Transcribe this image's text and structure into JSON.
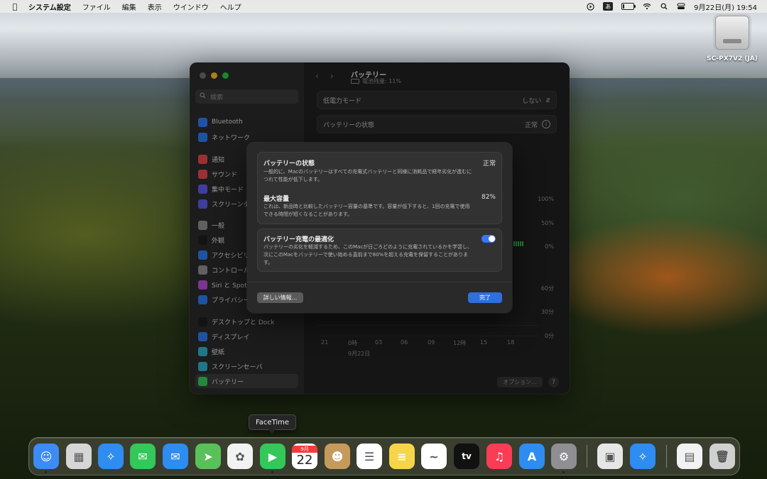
{
  "menubar": {
    "app_name": "システム設定",
    "menus": [
      "ファイル",
      "編集",
      "表示",
      "ウインドウ",
      "ヘルプ"
    ],
    "ime_label": "あ",
    "clock": "9月22日(月) 19:54",
    "battery_level": 0.11
  },
  "desktop": {
    "drive_label": "SC-PX7V2 (JA)"
  },
  "window": {
    "search_placeholder": "検索",
    "sidebar": [
      {
        "label": "Bluetooth",
        "icon": "bluetooth-icon",
        "color": "#2d7bf0"
      },
      {
        "label": "ネットワーク",
        "icon": "globe-icon",
        "color": "#2d7bf0"
      },
      {
        "label": "通知",
        "icon": "bell-icon",
        "color": "#e5484d"
      },
      {
        "label": "サウンド",
        "icon": "speaker-icon",
        "color": "#e5484d"
      },
      {
        "label": "集中モード",
        "icon": "moon-icon",
        "color": "#5e5ce6"
      },
      {
        "label": "スクリーンタ",
        "icon": "hourglass-icon",
        "color": "#5e5ce6"
      },
      {
        "label": "一般",
        "icon": "gear-icon",
        "color": "#8e8e93"
      },
      {
        "label": "外観",
        "icon": "appearance-icon",
        "color": "#1c1c1e"
      },
      {
        "label": "アクセシビリ",
        "icon": "accessibility-icon",
        "color": "#2d7bf0"
      },
      {
        "label": "コントロール",
        "icon": "control-center-icon",
        "color": "#8e8e93"
      },
      {
        "label": "Siri と Spotli",
        "icon": "siri-icon",
        "color": "#b44fd6"
      },
      {
        "label": "プライバシー",
        "icon": "hand-icon",
        "color": "#2d7bf0"
      },
      {
        "label": "デスクトップと Dock",
        "icon": "dock-icon",
        "color": "#1c1c1e"
      },
      {
        "label": "ディスプレイ",
        "icon": "sun-icon",
        "color": "#2d7bf0"
      },
      {
        "label": "壁紙",
        "icon": "wallpaper-icon",
        "color": "#30b0c7"
      },
      {
        "label": "スクリーンセーバ",
        "icon": "screensaver-icon",
        "color": "#30b0c7"
      },
      {
        "label": "バッテリー",
        "icon": "battery-icon",
        "color": "#34c759"
      }
    ],
    "title": "バッテリー",
    "subtitle": "電池残量: 11%",
    "low_power_label": "低電力モード",
    "low_power_value": "しない",
    "health_label": "バッテリーの状態",
    "health_value": "正常",
    "chart_percent_labels": [
      "100%",
      "50%",
      "0%"
    ],
    "chart_minute_labels": [
      "60分",
      "30分",
      "0分"
    ],
    "chart_x_labels": [
      "21",
      "0時",
      "03",
      "06",
      "09",
      "12時",
      "15",
      "18"
    ],
    "chart_date_label": "9月22日",
    "options_label": "オプション...",
    "help_label": "?"
  },
  "sheet": {
    "health_title": "バッテリーの状態",
    "health_value": "正常",
    "health_desc": "一般的に、Macのバッテリーはすべての充電式バッテリーと同様に消耗品で経年劣化が進むにつれて性能が低下します。",
    "capacity_title": "最大容量",
    "capacity_value": "82%",
    "capacity_desc": "これは、新品時と比較したバッテリー容量の基準です。容量が低下すると、1回の充電で使用できる時間が短くなることがあります。",
    "optimize_title": "バッテリー充電の最適化",
    "optimize_desc": "バッテリーの劣化を軽減するため、このMacが日ごろどのように充電されているかを学習し、次にこのMacをバッテリーで使い始める直前まで80%を超える充電を保留することがあります。",
    "optimize_on": true,
    "more_info_label": "詳しい情報...",
    "done_label": "完了"
  },
  "dock": {
    "tooltip": "FaceTime",
    "calendar_month": "9月",
    "calendar_day": "22",
    "tv_label": "tv",
    "apps": [
      {
        "name": "finder-icon",
        "color": "#3d8bf5"
      },
      {
        "name": "launchpad-icon",
        "color": "#d6d6d6"
      },
      {
        "name": "safari-icon",
        "color": "#2f8cf0"
      },
      {
        "name": "messages-icon",
        "color": "#34c759"
      },
      {
        "name": "mail-icon",
        "color": "#2f8cf0"
      },
      {
        "name": "maps-icon",
        "color": "#5ac05a"
      },
      {
        "name": "photos-icon",
        "color": "#f2f2f2"
      },
      {
        "name": "facetime-icon",
        "color": "#34c759"
      },
      {
        "name": "calendar-icon",
        "color": "#ffffff"
      },
      {
        "name": "contacts-icon",
        "color": "#c69a5b"
      },
      {
        "name": "reminders-icon",
        "color": "#ffffff"
      },
      {
        "name": "notes-icon",
        "color": "#f7d54a"
      },
      {
        "name": "freeform-icon",
        "color": "#ffffff"
      },
      {
        "name": "tv-icon",
        "color": "#111111"
      },
      {
        "name": "music-icon",
        "color": "#fa3c55"
      },
      {
        "name": "app-store-icon",
        "color": "#2f8cf0"
      },
      {
        "name": "system-settings-icon",
        "color": "#8e8e93"
      },
      {
        "name": "preview-icon",
        "color": "#e6e6e6"
      },
      {
        "name": "safari-update-icon",
        "color": "#2f8cf0"
      },
      {
        "name": "document-icon",
        "color": "#f2f2f2"
      },
      {
        "name": "trash-icon",
        "color": "#d0d0d0"
      }
    ]
  }
}
